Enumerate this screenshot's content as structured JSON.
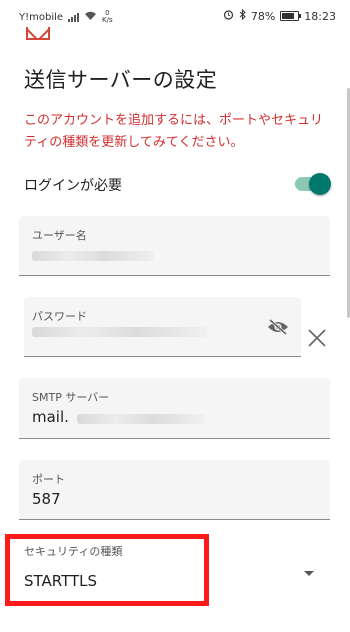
{
  "status_bar": {
    "carrier": "Y!mobile",
    "net_speed_value": "0",
    "net_speed_unit": "K/s",
    "battery_percent": "78%",
    "battery_level": 0.78,
    "time": "18:23"
  },
  "page": {
    "title": "送信サーバーの設定",
    "error_message": "このアカウントを追加するには、ポートやセキュリティの種類を更新してみてください。"
  },
  "login_required": {
    "label": "ログインが必要",
    "enabled": true
  },
  "fields": {
    "username": {
      "label": "ユーザー名",
      "value": ""
    },
    "password": {
      "label": "パスワード",
      "value": ""
    },
    "smtp_server": {
      "label": "SMTP サーバー",
      "value_prefix": "mail."
    },
    "port": {
      "label": "ポート",
      "value": "587"
    },
    "security_type": {
      "label": "セキュリティの種類",
      "value": "STARTTLS"
    }
  },
  "colors": {
    "error": "#d32f2f",
    "accent": "#00796b",
    "highlight": "#ff1a1a"
  }
}
